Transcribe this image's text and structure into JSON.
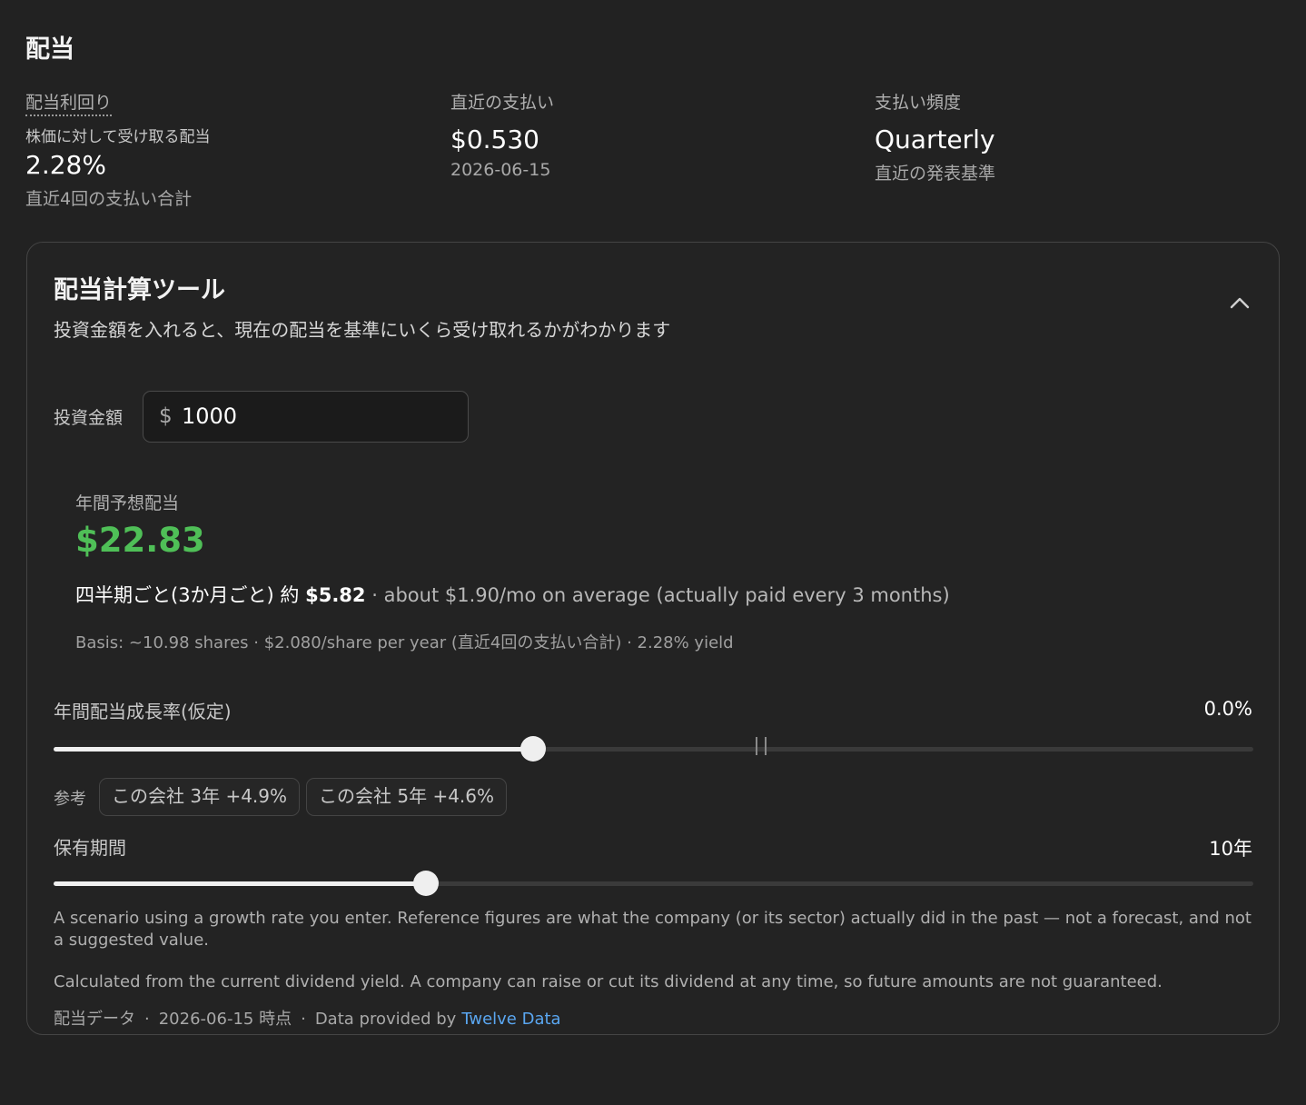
{
  "page": {
    "title": "配当"
  },
  "stats": {
    "yield": {
      "label": "配当利回り",
      "description": "株価に対して受け取る配当",
      "value": "2.28%",
      "sub": "直近4回の支払い合計"
    },
    "last_payment": {
      "label": "直近の支払い",
      "value": "$0.530",
      "sub": "2026-06-15"
    },
    "frequency": {
      "label": "支払い頻度",
      "value": "Quarterly",
      "sub": "直近の発表基準"
    }
  },
  "calculator": {
    "title": "配当計算ツール",
    "subtitle": "投資金額を入れると、現在の配当を基準にいくら受け取れるかがわかります",
    "collapse_icon": "chevron-up-icon",
    "amount": {
      "label": "投資金額",
      "currency": "$",
      "value": "1000"
    },
    "result": {
      "label": "年間予想配当",
      "value": "$22.83",
      "per_period_prefix": "四半期ごと(3か月ごと) 約",
      "per_period_amount": "$5.82",
      "per_period_note": "· about $1.90/mo on average (actually paid every 3 months)",
      "basis": "Basis: ~10.98 shares · $2.080/share per year (直近4回の支払い合計) · 2.28% yield"
    },
    "growth": {
      "label": "年間配当成長率(仮定)",
      "value": "0.0%",
      "slider_fraction": 0.4,
      "zero_fraction": 0.59,
      "reference_label": "参考",
      "references": [
        "この会社 3年 +4.9%",
        "この会社 5年 +4.6%"
      ]
    },
    "holding": {
      "label": "保有期間",
      "value": "10年",
      "slider_fraction": 0.31
    },
    "notes": [
      "A scenario using a growth rate you enter. Reference figures are what the company (or its sector) actually did in the past — not a forecast, and not a suggested value.",
      "Calculated from the current dividend yield. A company can raise or cut its dividend at any time, so future amounts are not guaranteed."
    ],
    "footer": {
      "source_label": "配当データ",
      "as_of": "2026-06-15 時点",
      "provided_by": "Data provided by",
      "provider_link": "Twelve Data"
    }
  },
  "colors": {
    "background": "#222222",
    "accent_green": "#4fbf57",
    "link_blue": "#5aa6f0"
  }
}
